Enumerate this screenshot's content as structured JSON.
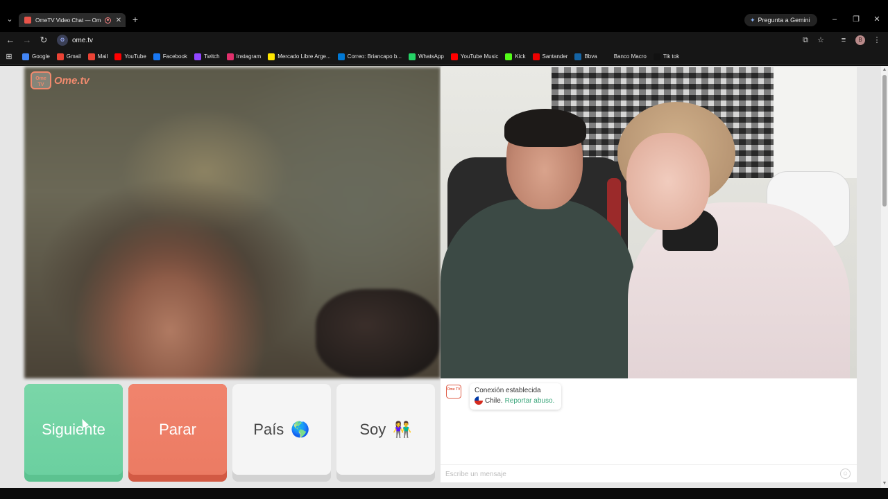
{
  "browser": {
    "tab": {
      "title": "OmeTV Video Chat — Ome"
    },
    "gemini_label": "Pregunta a Gemini",
    "url": "ome.tv",
    "profile_initial": "B",
    "bookmarks": [
      {
        "label": "Google",
        "color": "#4285f4"
      },
      {
        "label": "Gmail",
        "color": "#ea4335"
      },
      {
        "label": "Mail",
        "color": "#ea4335"
      },
      {
        "label": "YouTube",
        "color": "#ff0000"
      },
      {
        "label": "Facebook",
        "color": "#1877f2"
      },
      {
        "label": "Twitch",
        "color": "#9146ff"
      },
      {
        "label": "Instagram",
        "color": "#e1306c"
      },
      {
        "label": "Mercado Libre Arge...",
        "color": "#ffe600"
      },
      {
        "label": "Correo: Briancapo b...",
        "color": "#0078d4"
      },
      {
        "label": "WhatsApp",
        "color": "#25d366"
      },
      {
        "label": "YouTube Music",
        "color": "#ff0000"
      },
      {
        "label": "Kick",
        "color": "#53fc18"
      },
      {
        "label": "Santander",
        "color": "#ec0000"
      },
      {
        "label": "Bbva",
        "color": "#1464a5"
      },
      {
        "label": "Banco Macro",
        "color": "#161616"
      },
      {
        "label": "Tik tok",
        "color": "#111111"
      }
    ]
  },
  "site": {
    "logo_badge": "Ome TV",
    "logo_text": "Ome.tv",
    "buttons": {
      "next": "Siguiente",
      "stop": "Parar",
      "country": "País",
      "country_emoji": "🌎",
      "gender": "Soy",
      "gender_emoji": "👫"
    },
    "chat": {
      "logo_badge": "Ome TV",
      "status": "Conexión establecida",
      "country": "Chile.",
      "report_link": "Reportar abuso.",
      "input_placeholder": "Escribe un mensaje"
    }
  },
  "colors": {
    "next_button": "#6bd0a0",
    "stop_button": "#ec7b63",
    "brand": "#f08a6e",
    "report_link": "#3aa57a"
  }
}
